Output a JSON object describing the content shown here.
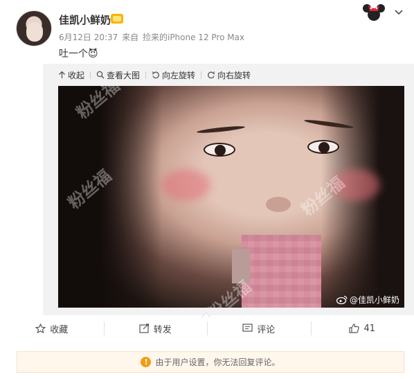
{
  "post": {
    "username": "佳凯小鲜奶",
    "date": "6月12日 20:37",
    "source_prefix": "来自",
    "source": "捡来的iPhone 12 Pro Max",
    "text": "吐一个😈"
  },
  "image_toolbar": {
    "collapse": "收起",
    "view_large": "查看大图",
    "rotate_left": "向左旋转",
    "rotate_right": "向右旋转"
  },
  "photo": {
    "watermark_text": "粉丝福",
    "handle": "@佳凯小鲜奶"
  },
  "actions": {
    "favorite": "收藏",
    "repost": "转发",
    "comment": "评论",
    "like_count": "41"
  },
  "notice": {
    "icon": "!",
    "text": "由于用户设置，你无法回复评论。"
  },
  "colors": {
    "accent": "#f39c12",
    "notice_bg": "#fff7ec",
    "viewer_bg": "#f2f2f2"
  }
}
